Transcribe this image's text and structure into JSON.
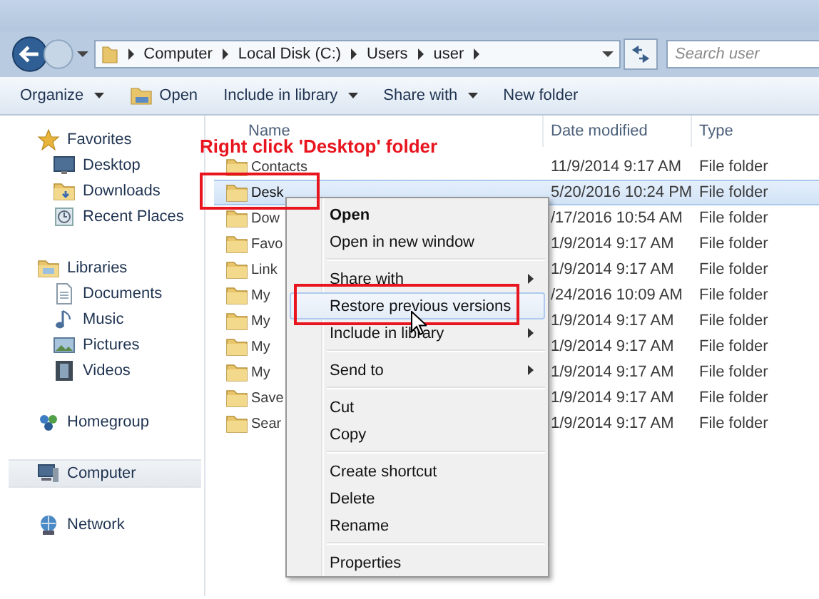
{
  "address_bar": {
    "breadcrumbs": [
      "Computer",
      "Local Disk (C:)",
      "Users",
      "user"
    ]
  },
  "search": {
    "placeholder": "Search user"
  },
  "toolbar": [
    {
      "label": "Organize",
      "dropdown": true
    },
    {
      "label": "Open",
      "dropdown": false
    },
    {
      "label": "Include in library",
      "dropdown": true
    },
    {
      "label": "Share with",
      "dropdown": true
    },
    {
      "label": "New folder",
      "dropdown": false
    }
  ],
  "sidebar": [
    {
      "label": "Favorites",
      "selected": false,
      "children": [
        {
          "label": "Desktop",
          "selected": false
        },
        {
          "label": "Downloads",
          "selected": false
        },
        {
          "label": "Recent Places",
          "selected": false
        }
      ]
    },
    {
      "label": "Libraries",
      "selected": false,
      "children": [
        {
          "label": "Documents",
          "selected": false
        },
        {
          "label": "Music",
          "selected": false
        },
        {
          "label": "Pictures",
          "selected": false
        },
        {
          "label": "Videos",
          "selected": false
        }
      ]
    },
    {
      "label": "Homegroup",
      "selected": false
    },
    {
      "label": "Computer",
      "selected": true
    },
    {
      "label": "Network",
      "selected": false
    }
  ],
  "columns": [
    "Name",
    "Date modified",
    "Type"
  ],
  "rows": [
    {
      "name": "Contacts",
      "date": "11/9/2014 9:17 AM",
      "type": "File folder",
      "selected": false
    },
    {
      "name": "Desk",
      "date": "5/20/2016 10:24 PM",
      "type": "File folder",
      "selected": true
    },
    {
      "name": "Dow",
      "date": "/17/2016 10:54 AM",
      "type": "File folder",
      "selected": false
    },
    {
      "name": "Favo",
      "date": "1/9/2014 9:17 AM",
      "type": "File folder",
      "selected": false
    },
    {
      "name": "Link",
      "date": "1/9/2014 9:17 AM",
      "type": "File folder",
      "selected": false
    },
    {
      "name": "My",
      "date": "/24/2016 10:09 AM",
      "type": "File folder",
      "selected": false
    },
    {
      "name": "My",
      "date": "1/9/2014 9:17 AM",
      "type": "File folder",
      "selected": false
    },
    {
      "name": "My",
      "date": "1/9/2014 9:17 AM",
      "type": "File folder",
      "selected": false
    },
    {
      "name": "My",
      "date": "1/9/2014 9:17 AM",
      "type": "File folder",
      "selected": false
    },
    {
      "name": "Save",
      "date": "1/9/2014 9:17 AM",
      "type": "File folder",
      "selected": false
    },
    {
      "name": "Sear",
      "date": "1/9/2014 9:17 AM",
      "type": "File folder",
      "selected": false
    }
  ],
  "context_menu": [
    {
      "kind": "item",
      "label": "Open",
      "default": true,
      "submenu": false,
      "selected": false
    },
    {
      "kind": "item",
      "label": "Open in new window",
      "default": false,
      "submenu": false,
      "selected": false
    },
    {
      "kind": "separator"
    },
    {
      "kind": "item",
      "label": "Share with",
      "default": false,
      "submenu": true,
      "selected": false
    },
    {
      "kind": "item",
      "label": "Restore previous versions",
      "default": false,
      "submenu": false,
      "selected": true
    },
    {
      "kind": "item",
      "label": "Include in library",
      "default": false,
      "submenu": true,
      "selected": false
    },
    {
      "kind": "separator"
    },
    {
      "kind": "item",
      "label": "Send to",
      "default": false,
      "submenu": true,
      "selected": false
    },
    {
      "kind": "separator"
    },
    {
      "kind": "item",
      "label": "Cut",
      "default": false,
      "submenu": false,
      "selected": false
    },
    {
      "kind": "item",
      "label": "Copy",
      "default": false,
      "submenu": false,
      "selected": false
    },
    {
      "kind": "separator"
    },
    {
      "kind": "item",
      "label": "Create shortcut",
      "default": false,
      "submenu": false,
      "selected": false
    },
    {
      "kind": "item",
      "label": "Delete",
      "default": false,
      "submenu": false,
      "selected": false
    },
    {
      "kind": "item",
      "label": "Rename",
      "default": false,
      "submenu": false,
      "selected": false
    },
    {
      "kind": "separator"
    },
    {
      "kind": "item",
      "label": "Properties",
      "default": false,
      "submenu": false,
      "selected": false
    }
  ],
  "annotation": {
    "text": "Right click 'Desktop' folder"
  }
}
